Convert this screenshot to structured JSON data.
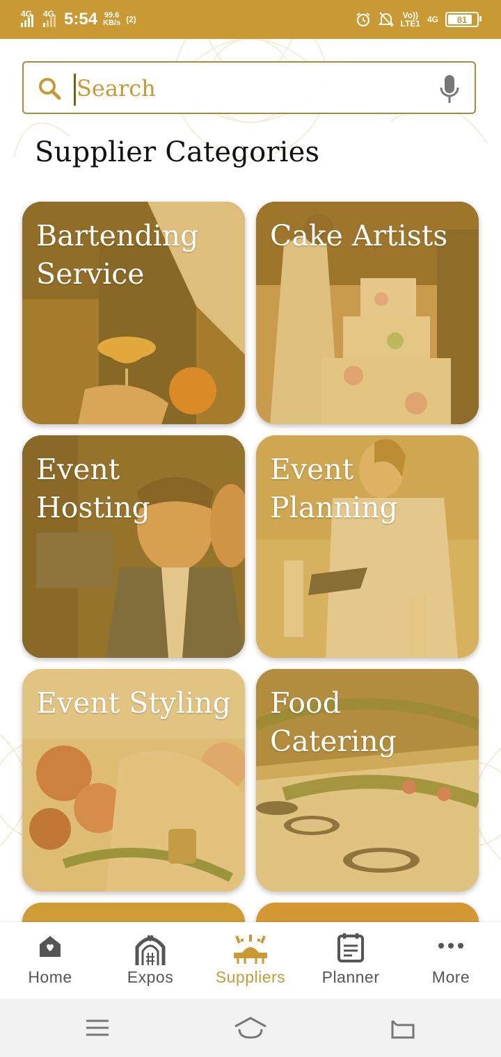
{
  "status_bar": {
    "network1": "4G",
    "network2": "4G",
    "time": "5:54",
    "speed_value": "99.6",
    "speed_unit": "KB/s",
    "hotspot": "(2)",
    "volte_top": "Vo))",
    "volte_bottom": "LTE1",
    "network3": "4G",
    "battery": "81"
  },
  "search": {
    "placeholder": "Search"
  },
  "page_title": "Supplier Categories",
  "categories": [
    {
      "label": "Bartending Service"
    },
    {
      "label": "Cake Artists"
    },
    {
      "label": "Event Hosting"
    },
    {
      "label": "Event Planning"
    },
    {
      "label": "Event Styling"
    },
    {
      "label": "Food Catering"
    }
  ],
  "bottom_nav": {
    "items": [
      {
        "label": "Home",
        "icon": "home-icon"
      },
      {
        "label": "Expos",
        "icon": "venue-arch-icon"
      },
      {
        "label": "Suppliers",
        "icon": "suppliers-table-icon"
      },
      {
        "label": "Planner",
        "icon": "planner-document-icon"
      },
      {
        "label": "More",
        "icon": "more-dots-icon"
      }
    ],
    "active": "Suppliers"
  },
  "colors": {
    "accent": "#c99a33",
    "tint": "#d5a53c",
    "inactive": "#555555"
  }
}
